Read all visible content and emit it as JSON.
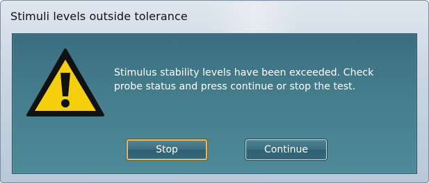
{
  "window": {
    "title": "Stimuli levels outside tolerance"
  },
  "dialog": {
    "icon": "warning-triangle-icon",
    "message": "Stimulus stability levels have been exceeded. Check\nprobe status and press continue or stop the test.",
    "buttons": {
      "stop_label": "Stop",
      "continue_label": "Continue"
    }
  },
  "colors": {
    "content_background": "#447c8c",
    "warning_yellow": "#f5cf0c",
    "default_button_outline": "#e3b96a"
  }
}
